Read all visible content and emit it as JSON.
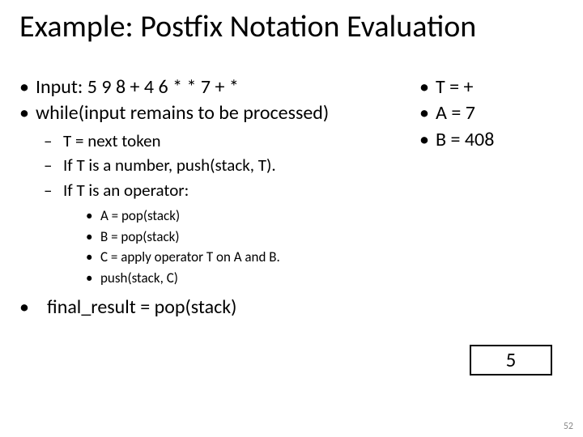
{
  "title": "Example: Postfix Notation Evaluation",
  "left": {
    "input_line": "Input:   5 9 8 + 4 6 * * 7 + *",
    "while_line": "while(input remains to be processed)",
    "sub": {
      "t_next": "T = next token",
      "if_num": "If T is a number, push(stack, T).",
      "if_op": "If T is an operator:",
      "ops": {
        "a": "A = pop(stack)",
        "b": "B = pop(stack)",
        "c": "C = apply operator T on A and B.",
        "d": "push(stack, C)"
      }
    },
    "final": "final_result = pop(stack)"
  },
  "right": {
    "t": "T = +",
    "a": "A = 7",
    "b": "B = 408"
  },
  "stack": {
    "cell0": "5"
  },
  "page": "52"
}
